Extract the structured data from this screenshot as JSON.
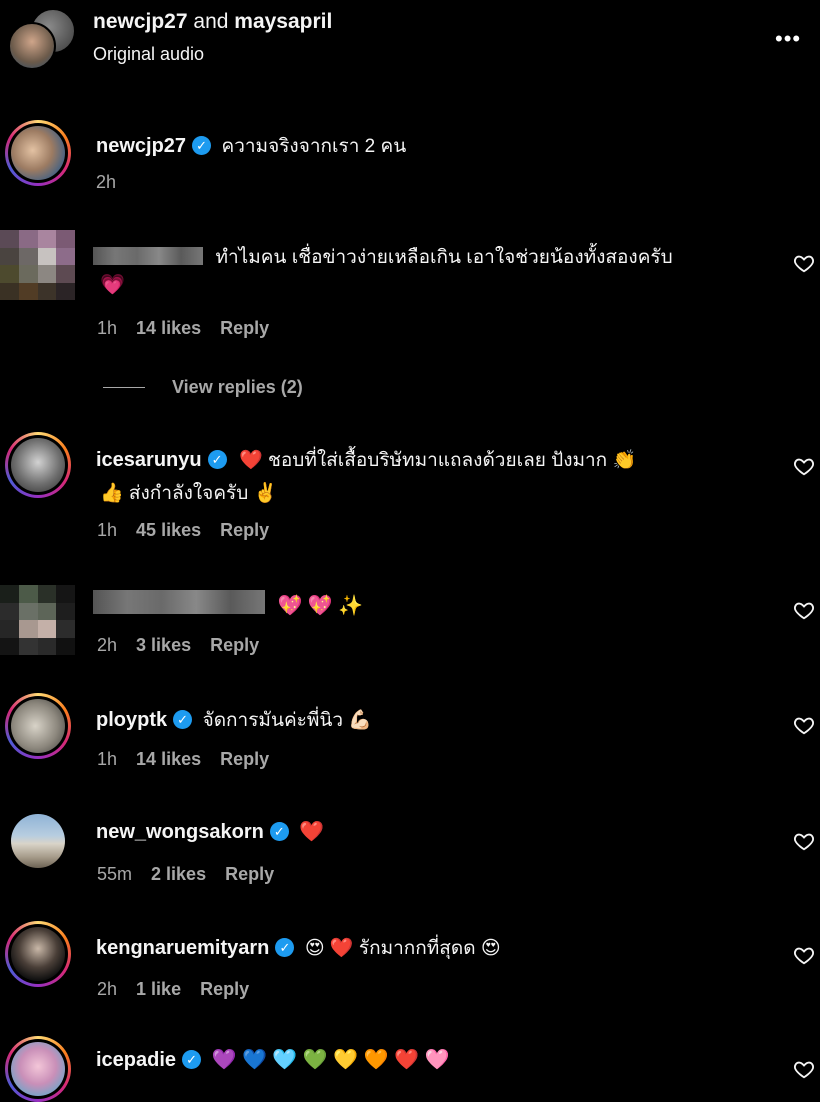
{
  "header": {
    "user1": "newcjp27",
    "joiner": "and",
    "user2": "maysapril",
    "subtitle": "Original audio",
    "more_icon": "more-horizontal-icon"
  },
  "caption": {
    "username": "newcjp27",
    "text": "ความจริงจากเรา 2 คน",
    "time": "2h"
  },
  "comments": [
    {
      "username": "",
      "line1": "ทำไมคน เชื่อข่าวง่ายเหลือเกิน เอาใจช่วยน้องทั้งสองครับ",
      "line2": "💗",
      "time": "1h",
      "likes": "14 likes",
      "reply": "Reply",
      "view_replies": "View replies (2)"
    },
    {
      "username": "icesarunyu",
      "line1": "❤️  ชอบที่ใส่เสื้อบริษัทมาแถลงด้วยเลย ปังมาก 👏",
      "line2": "👍 ส่งกำลังใจครับ ✌️",
      "time": "1h",
      "likes": "45 likes",
      "reply": "Reply"
    },
    {
      "username": "",
      "line1": "💖 💖 ✨",
      "time": "2h",
      "likes": "3 likes",
      "reply": "Reply"
    },
    {
      "username": "ployptk",
      "line1": "จัดการมันค่ะพี่นิว 💪🏻",
      "time": "1h",
      "likes": "14 likes",
      "reply": "Reply"
    },
    {
      "username": "new_wongsakorn",
      "line1": "❤️",
      "time": "55m",
      "likes": "2 likes",
      "reply": "Reply"
    },
    {
      "username": "kengnaruemityarn",
      "line1": "😍 ❤️  รักมากกที่สุดด 😍",
      "time": "2h",
      "likes": "1 like",
      "reply": "Reply"
    },
    {
      "username": "icepadie",
      "line1": "💜 💙 🩵 💚 💛 🧡 ❤️ 🩷"
    }
  ],
  "icons": {
    "verified": "✓",
    "heart": "heart-outline-icon"
  },
  "colors": {
    "background": "#000000",
    "text": "#f5f5f5",
    "muted": "#a8a8a8",
    "verified": "#1d9bf0"
  }
}
